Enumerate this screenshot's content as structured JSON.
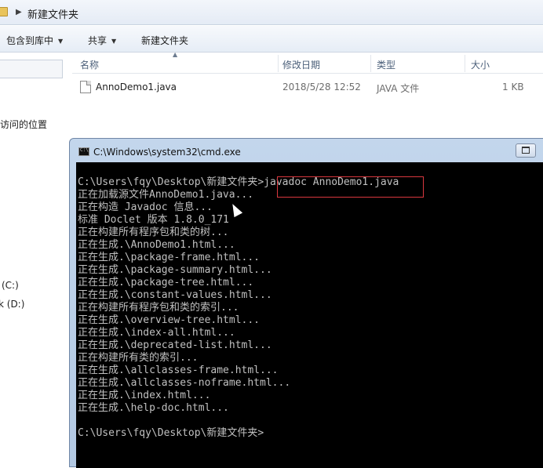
{
  "explorer": {
    "path_label": "新建文件夹",
    "toolbar": {
      "include_library": "包含到库中",
      "share": "共享",
      "new_folder": "新建文件夹"
    },
    "sidebar": {
      "recent_places": "访问的位置",
      "drive_c": "(C:)",
      "drive_d": "k (D:)"
    },
    "columns": {
      "name": "名称",
      "date": "修改日期",
      "type": "类型",
      "size": "大小"
    },
    "files": [
      {
        "name": "AnnoDemo1.java",
        "date": "2018/5/28 12:52",
        "type": "JAVA 文件",
        "size": "1 KB"
      }
    ]
  },
  "cmd": {
    "title": "C:\\Windows\\system32\\cmd.exe",
    "lines": [
      "C:\\Users\\fqy\\Desktop\\新建文件夹>javadoc AnnoDemo1.java",
      "正在加载源文件AnnoDemo1.java...",
      "正在构造 Javadoc 信息...",
      "标准 Doclet 版本 1.8.0_171",
      "正在构建所有程序包和类的树...",
      "正在生成.\\AnnoDemo1.html...",
      "正在生成.\\package-frame.html...",
      "正在生成.\\package-summary.html...",
      "正在生成.\\package-tree.html...",
      "正在生成.\\constant-values.html...",
      "正在构建所有程序包和类的索引...",
      "正在生成.\\overview-tree.html...",
      "正在生成.\\index-all.html...",
      "正在生成.\\deprecated-list.html...",
      "正在构建所有类的索引...",
      "正在生成.\\allclasses-frame.html...",
      "正在生成.\\allclasses-noframe.html...",
      "正在生成.\\index.html...",
      "正在生成.\\help-doc.html...",
      "",
      "C:\\Users\\fqy\\Desktop\\新建文件夹>"
    ],
    "highlight_color": "#d9383f",
    "background_color": "#000000",
    "text_color": "#c0c0c0"
  },
  "icons": [
    "folder-icon",
    "java-file-icon",
    "cmd-icon",
    "maximize-icon",
    "mouse-cursor-icon"
  ]
}
